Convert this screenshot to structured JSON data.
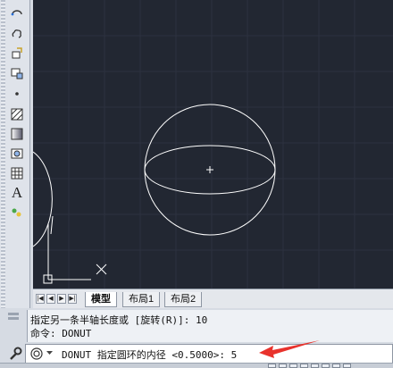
{
  "toolbar": {
    "tools": [
      {
        "name": "ellipse-arc-icon"
      },
      {
        "name": "revision-cloud-icon"
      },
      {
        "name": "insert-block-icon"
      },
      {
        "name": "make-block-icon"
      },
      {
        "name": "point-icon"
      },
      {
        "name": "hatch-icon"
      },
      {
        "name": "gradient-icon"
      },
      {
        "name": "region-icon"
      },
      {
        "name": "table-icon"
      },
      {
        "name": "multiline-text-icon",
        "glyph": "A"
      },
      {
        "name": "add-selected-icon"
      }
    ]
  },
  "layout_tabs": {
    "nav_glyphs": [
      "|◀",
      "◀",
      "▶",
      "▶|"
    ],
    "tabs": [
      {
        "label": "模型",
        "active": true
      },
      {
        "label": "布局1",
        "active": false
      },
      {
        "label": "布局2",
        "active": false
      }
    ]
  },
  "command": {
    "history": [
      "指定另一条半轴长度或 [旋转(R)]: 10",
      "命令: DONUT"
    ],
    "prompt": "DONUT 指定圆环的内径 <0.5000>: 5"
  },
  "colors": {
    "canvas_bg": "#222732",
    "geometry": "#ffffff",
    "arrow": "#e8322c",
    "ucs": "#ffffff"
  }
}
